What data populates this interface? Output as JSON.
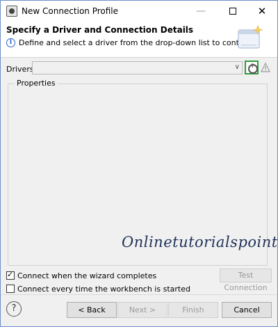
{
  "window": {
    "title": "New Connection Profile",
    "minimize_glyph": "—",
    "close_glyph": "✕"
  },
  "header": {
    "title": "Specify a Driver and Connection Details",
    "description": "Define and select a driver from the drop-down list to continue.",
    "info_glyph": "i"
  },
  "drivers": {
    "label": "Drivers:",
    "selected": "",
    "arrow_glyph": "∨"
  },
  "properties": {
    "legend": "Properties"
  },
  "watermark": "Onlinetutorialspoint",
  "options": {
    "connect_on_complete": {
      "label": "Connect when the wizard completes",
      "checked": true
    },
    "connect_on_startup": {
      "label": "Connect every time the workbench is started",
      "checked": false
    }
  },
  "test_connection_label": "Test Connection",
  "footer": {
    "help_glyph": "?",
    "back_label": "< Back",
    "next_label": "Next >",
    "finish_label": "Finish",
    "cancel_label": "Cancel"
  },
  "colors": {
    "accent_highlight": "#2e9c3c",
    "info_blue": "#2a64c6",
    "window_border": "#6f8fc9"
  },
  "icons": {
    "app": "database-connection-icon",
    "info": "info-icon",
    "new_driver": "new-driver-icon",
    "edit_driver": "edit-driver-warning-icon",
    "help": "help-icon",
    "banner": "wizard-banner-icon"
  }
}
